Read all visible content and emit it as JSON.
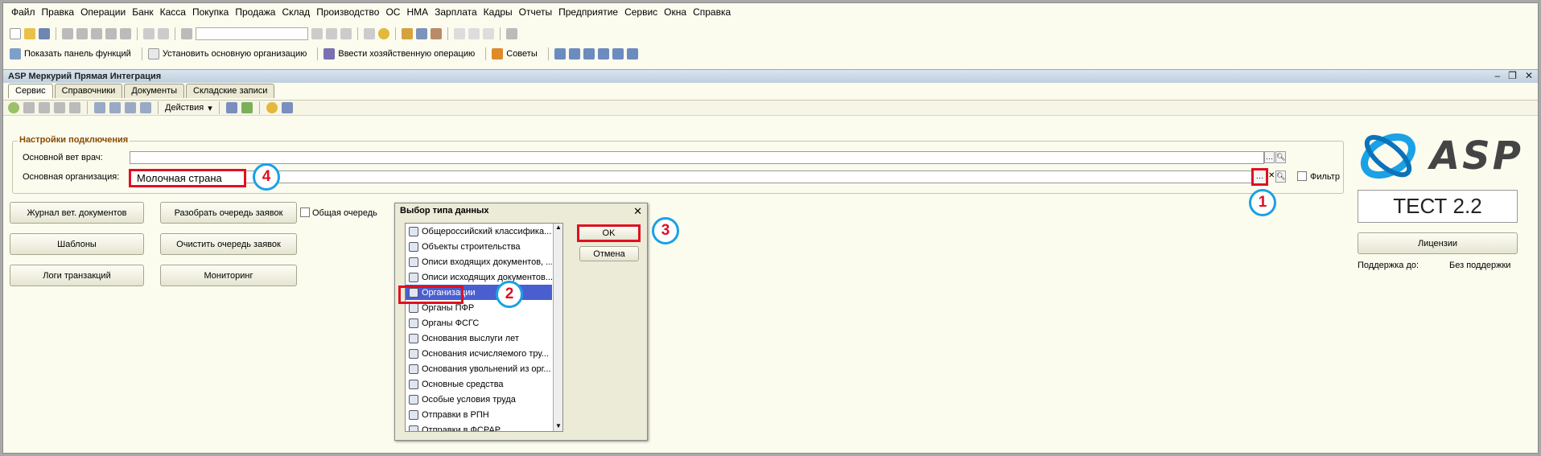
{
  "menu": [
    "Файл",
    "Правка",
    "Операции",
    "Банк",
    "Касса",
    "Покупка",
    "Продажа",
    "Склад",
    "Производство",
    "ОС",
    "НМА",
    "Зарплата",
    "Кадры",
    "Отчеты",
    "Предприятие",
    "Сервис",
    "Окна",
    "Справка"
  ],
  "toolbar2": {
    "show_panel": "Показать панель функций",
    "set_org": "Установить основную организацию",
    "enter_op": "Ввести хозяйственную операцию",
    "tips": "Советы"
  },
  "window": {
    "title": "ASP Меркурий Прямая Интеграция"
  },
  "tabs": [
    "Сервис",
    "Справочники",
    "Документы",
    "Складские записи"
  ],
  "actions": "Действия",
  "settings": {
    "legend": "Настройки подключения",
    "vet_label": "Основной вет врач:",
    "org_label": "Основная организация:",
    "org_value": "Молочная страна",
    "filter_label": "Фильтр"
  },
  "buttons": {
    "journal": "Журнал вет. документов",
    "parse_queue": "Разобрать очередь заявок",
    "common_queue": "Общая очередь",
    "templates": "Шаблоны",
    "clear_queue": "Очистить очередь заявок",
    "logs": "Логи транзакций",
    "monitoring": "Мониторинг"
  },
  "dialog": {
    "title": "Выбор типа данных",
    "ok": "OK",
    "cancel": "Отмена",
    "items": [
      "Общероссийский классифика...",
      "Объекты строительства",
      "Описи входящих документов, ...",
      "Описи исходящих документов...",
      "Организации",
      "Органы ПФР",
      "Органы ФСГС",
      "Основания выслуги лет",
      "Основания исчисляемого тру...",
      "Основания увольнений из орг...",
      "Основные средства",
      "Особые условия труда",
      "Отправки в РПН",
      "Отправки в ФСРАР"
    ],
    "selected": 4
  },
  "annotations": [
    "1",
    "2",
    "3",
    "4"
  ],
  "right": {
    "logo": "ASP",
    "test": "ТЕСТ 2.2",
    "licenses": "Лицензии",
    "support_label": "Поддержка до:",
    "support_value": "Без поддержки"
  },
  "colors": {
    "highlight": "#e01020",
    "circle": "#1aa1e6",
    "selection": "#4a5fcf"
  }
}
